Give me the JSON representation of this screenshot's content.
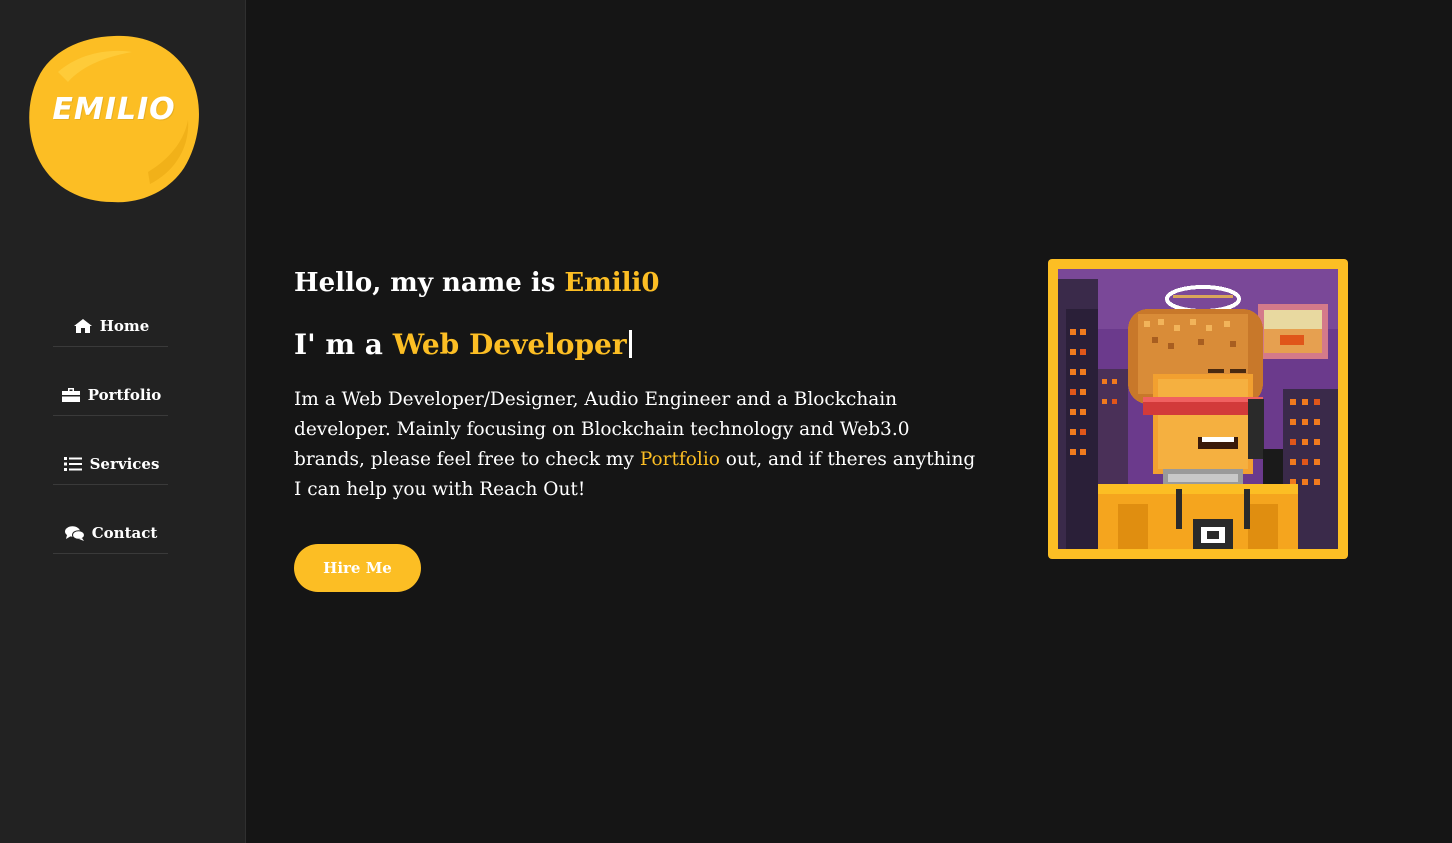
{
  "brand": {
    "logo_text": "EMILIO",
    "accent_color": "#fcbe24",
    "background_color": "#151515",
    "sidebar_color": "#222222"
  },
  "sidebar": {
    "items": [
      {
        "label": "Home",
        "icon": "home-icon"
      },
      {
        "label": "Portfolio",
        "icon": "briefcase-icon"
      },
      {
        "label": "Services",
        "icon": "list-icon"
      },
      {
        "label": "Contact",
        "icon": "comments-icon"
      }
    ]
  },
  "hero": {
    "greeting_prefix": "Hello, my name is ",
    "name": "Emili0",
    "role_prefix": "I' m a ",
    "role": "Web Developer",
    "intro_part1": "Im a Web Developer/Designer, Audio Engineer and a Blockchain developer. Mainly focusing on Blockchain technology and Web3.0 brands, please feel free to check my ",
    "intro_link": "Portfolio",
    "intro_part2": " out, and if theres anything I can help you with Reach Out!",
    "cta_label": "Hire Me",
    "avatar": "pixel-art-avatar"
  }
}
